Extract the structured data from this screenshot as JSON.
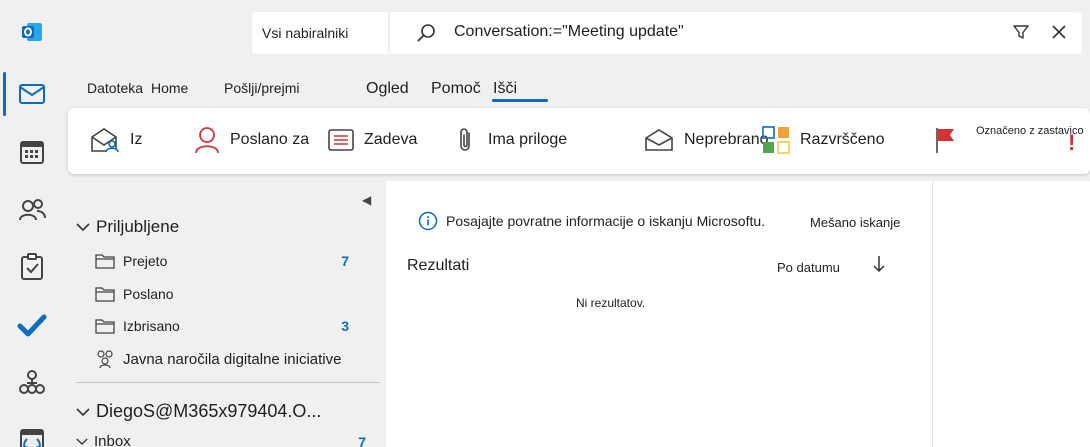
{
  "rail": {
    "items": [
      "outlook-logo",
      "mail-icon",
      "calendar-icon",
      "people-icon",
      "tasks-icon",
      "todo-icon",
      "org-icon",
      "bookings-icon"
    ]
  },
  "search": {
    "scope": "Vsi nabiralniki",
    "query": "Conversation:=\"Meeting update\""
  },
  "tabs": [
    "Datoteka",
    "Home",
    "Pošlji/prejmi",
    "Ogled",
    "Pomoč",
    "Išči"
  ],
  "ribbon": {
    "from": "Iz",
    "sent_to": "Poslano za",
    "subject": "Zadeva",
    "attachments": "Ima priloge",
    "unread": "Neprebrano",
    "categorized": "Razvrščeno",
    "flagged": "Označeno z zastavico"
  },
  "folders": {
    "favorites_label": "Priljubljene",
    "items": [
      {
        "name": "Prejeto",
        "count": "7"
      },
      {
        "name": "Poslano",
        "count": ""
      },
      {
        "name": "Izbrisano",
        "count": "3"
      }
    ],
    "group": "Javna naročila digitalne iniciative",
    "account": "DiegoS@M365x979404.O...",
    "inbox": {
      "name": "Inbox",
      "count": "7"
    }
  },
  "results": {
    "info": "Posajajte povratne informacije o iskanju Microsoftu.",
    "mixed": "Mešano iskanje",
    "title": "Rezultati",
    "sort": "Po datumu",
    "empty": "Ni rezultatov."
  },
  "colors": {
    "accent": "#0f6cbd",
    "red": "#d13438"
  }
}
